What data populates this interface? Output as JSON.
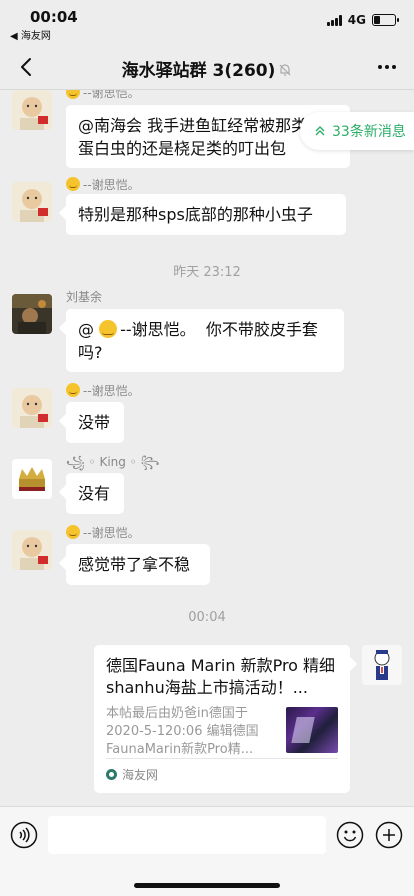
{
  "status_bar": {
    "time": "00:04",
    "back_app": "◀ 海友网",
    "network": "4G",
    "battery_level": 0.3
  },
  "nav": {
    "title": "海水驿站群 3(260)"
  },
  "new_messages": {
    "label": "33条新消息"
  },
  "messages": [
    {
      "sender": "--谢思恺。",
      "text": "@南海会 我手进鱼缸经常被那类似蛋白虫的还是桡足类的叮出包"
    },
    {
      "sender": "--谢思恺。",
      "text": "特别是那种sps底部的那种小虫子"
    },
    {
      "sender": "刘基余",
      "text_prefix": "@",
      "text_mention": "--谢思恺。",
      "text_suffix": "你不带胶皮手套吗?"
    },
    {
      "sender": "--谢思恺。",
      "text": "没带"
    },
    {
      "sender": "King",
      "text": "没有"
    },
    {
      "sender": "--谢思恺。",
      "text": "感觉带了拿不稳"
    }
  ],
  "time_separators": [
    "昨天 23:12",
    "00:04"
  ],
  "link_card": {
    "title": "德国Fauna Marin 新款Pro 精细shanhu海盐上市搞活动！...",
    "description": "本帖最后由奶爸in德国于2020-5-120:06 编辑德国FaunaMarin新款Pro精...",
    "source": "海友网"
  },
  "colors": {
    "background": "#ededed",
    "bubble": "#ffffff",
    "accent_green": "#2aae67",
    "meta_gray": "#888888"
  },
  "icons": {
    "back": "chevron-left-icon",
    "more": "more-dots-icon",
    "mute": "bell-off-icon",
    "voice": "voice-icon",
    "emoji": "emoji-face-icon",
    "plus": "plus-circle-icon",
    "new_messages": "double-chevron-up-icon"
  }
}
